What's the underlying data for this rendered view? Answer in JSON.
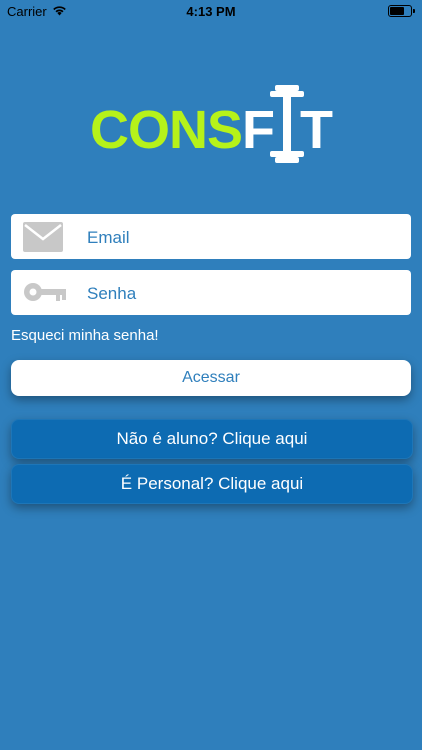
{
  "status": {
    "carrier": "Carrier",
    "time": "4:13 PM"
  },
  "logo": {
    "part1": "CONS",
    "part2_f": "F",
    "part2_i": "I",
    "part2_t": "T"
  },
  "email": {
    "placeholder": "Email",
    "icon": "mail-icon"
  },
  "password": {
    "placeholder": "Senha",
    "icon": "key-icon"
  },
  "forgot_label": "Esqueci minha senha!",
  "login_label": "Acessar",
  "signup_student_label": "Não é aluno? Clique aqui",
  "signup_personal_label": "É Personal? Clique aqui",
  "colors": {
    "background": "#2f7fbc",
    "accent": "#b6f21a",
    "button_blue": "#0d6bb2"
  }
}
